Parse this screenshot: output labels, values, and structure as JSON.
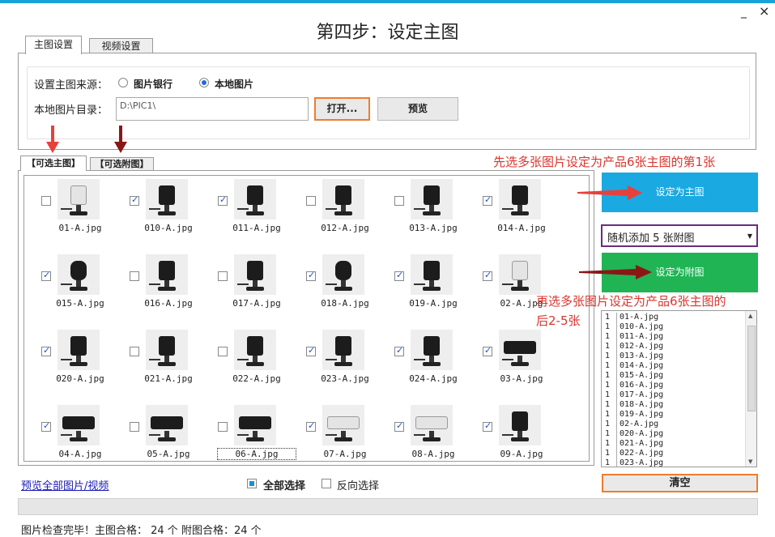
{
  "window": {
    "title": "第四步：设定主图",
    "minimize_glyph": "_",
    "close_glyph": "×"
  },
  "top_tabs": [
    {
      "label": "主图设置",
      "active": true
    },
    {
      "label": "视频设置",
      "active": false
    }
  ],
  "source": {
    "label": "设置主图来源：",
    "options": [
      {
        "label": "图片银行",
        "selected": false
      },
      {
        "label": "本地图片",
        "selected": true
      }
    ]
  },
  "local_dir": {
    "label": "本地图片目录：",
    "value": "D:\\PIC1\\",
    "open_button": "打开...",
    "preview_button": "预览"
  },
  "image_tabs": [
    {
      "label": "【可选主图】",
      "active": true
    },
    {
      "label": "【可选附图】",
      "active": false
    }
  ],
  "images": [
    {
      "name": "01-A.jpg",
      "checked": false,
      "style": "light"
    },
    {
      "name": "010-A.jpg",
      "checked": true,
      "style": "dark"
    },
    {
      "name": "011-A.jpg",
      "checked": true,
      "style": "dark"
    },
    {
      "name": "012-A.jpg",
      "checked": false,
      "style": "dark"
    },
    {
      "name": "013-A.jpg",
      "checked": false,
      "style": "dark"
    },
    {
      "name": "014-A.jpg",
      "checked": true,
      "style": "dark"
    },
    {
      "name": "015-A.jpg",
      "checked": true,
      "style": "round"
    },
    {
      "name": "016-A.jpg",
      "checked": false,
      "style": "dark"
    },
    {
      "name": "017-A.jpg",
      "checked": false,
      "style": "dark"
    },
    {
      "name": "018-A.jpg",
      "checked": true,
      "style": "round"
    },
    {
      "name": "019-A.jpg",
      "checked": true,
      "style": "dark"
    },
    {
      "name": "02-A.jpg",
      "checked": true,
      "style": "light"
    },
    {
      "name": "020-A.jpg",
      "checked": true,
      "style": "dark"
    },
    {
      "name": "021-A.jpg",
      "checked": false,
      "style": "dark"
    },
    {
      "name": "022-A.jpg",
      "checked": false,
      "style": "dark"
    },
    {
      "name": "023-A.jpg",
      "checked": true,
      "style": "dark"
    },
    {
      "name": "024-A.jpg",
      "checked": true,
      "style": "dark"
    },
    {
      "name": "03-A.jpg",
      "checked": true,
      "style": "wide"
    },
    {
      "name": "04-A.jpg",
      "checked": true,
      "style": "wide"
    },
    {
      "name": "05-A.jpg",
      "checked": false,
      "style": "wide"
    },
    {
      "name": "06-A.jpg",
      "checked": false,
      "style": "wide",
      "focused": true
    },
    {
      "name": "07-A.jpg",
      "checked": true,
      "style": "wide-light"
    },
    {
      "name": "08-A.jpg",
      "checked": true,
      "style": "wide-light"
    },
    {
      "name": "09-A.jpg",
      "checked": true,
      "style": "dark"
    }
  ],
  "annotations": {
    "step1": "先选多张图片设定为产品6张主图的第1张",
    "step2_line1": "再选多张图片设定为产品6张主图的",
    "step2_line2": "后2-5张"
  },
  "actions": {
    "set_main": "设定为主图",
    "set_main_color": "#1aa9e0",
    "random_select": "随机添加 5 张附图",
    "set_sub": "设定为附图",
    "set_sub_color": "#20b455",
    "clear": "清空"
  },
  "list": [
    {
      "col1": "1",
      "col2": "01-A.jpg"
    },
    {
      "col1": "1",
      "col2": "010-A.jpg"
    },
    {
      "col1": "1",
      "col2": "011-A.jpg"
    },
    {
      "col1": "1",
      "col2": "012-A.jpg"
    },
    {
      "col1": "1",
      "col2": "013-A.jpg"
    },
    {
      "col1": "1",
      "col2": "014-A.jpg"
    },
    {
      "col1": "1",
      "col2": "015-A.jpg"
    },
    {
      "col1": "1",
      "col2": "016-A.jpg"
    },
    {
      "col1": "1",
      "col2": "017-A.jpg"
    },
    {
      "col1": "1",
      "col2": "018-A.jpg"
    },
    {
      "col1": "1",
      "col2": "019-A.jpg"
    },
    {
      "col1": "1",
      "col2": "02-A.jpg"
    },
    {
      "col1": "1",
      "col2": "020-A.jpg"
    },
    {
      "col1": "1",
      "col2": "021-A.jpg"
    },
    {
      "col1": "1",
      "col2": "022-A.jpg"
    },
    {
      "col1": "1",
      "col2": "023-A.jpg"
    }
  ],
  "bottom": {
    "preview_all_link": "预览全部图片/视频",
    "select_all": "全部选择",
    "select_all_checked": true,
    "invert_select": "反向选择",
    "invert_checked": false,
    "status": "图片检查完毕！主图合格： 24 个  附图合格：24 个"
  }
}
